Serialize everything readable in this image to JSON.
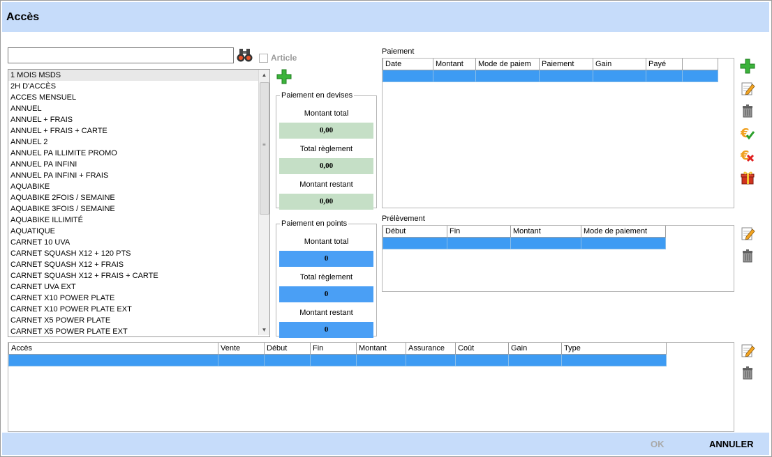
{
  "window": {
    "title": "Accès"
  },
  "search": {
    "value": "",
    "placeholder": ""
  },
  "article_checkbox": {
    "label": "Article",
    "checked": false
  },
  "access_list": {
    "selected_index": 0,
    "items": [
      "1 MOIS MSDS",
      "2H D'ACCÈS",
      "ACCES MENSUEL",
      "ANNUEL",
      "ANNUEL + FRAIS",
      "ANNUEL + FRAIS + CARTE",
      "ANNUEL 2",
      "ANNUEL PA ILLIMITE PROMO",
      "ANNUEL PA INFINI",
      "ANNUEL PA INFINI + FRAIS",
      "AQUABIKE",
      "AQUABIKE 2FOIS / SEMAINE",
      "AQUABIKE 3FOIS / SEMAINE",
      "AQUABIKE ILLIMITÉ",
      "AQUATIQUE",
      "CARNET 10 UVA",
      "CARNET SQUASH  X12 + 120 PTS",
      "CARNET SQUASH  X12 + FRAIS",
      "CARNET SQUASH  X12 + FRAIS + CARTE",
      "CARNET UVA EXT",
      "CARNET X10 POWER PLATE",
      "CARNET X10 POWER PLATE EXT",
      "CARNET X5 POWER PLATE",
      "CARNET X5 POWER PLATE EXT"
    ]
  },
  "currency_payment": {
    "legend": "Paiement en devises",
    "total_label": "Montant total",
    "total_value": "0,00",
    "paid_label": "Total règlement",
    "paid_value": "0,00",
    "remaining_label": "Montant restant",
    "remaining_value": "0,00"
  },
  "points_payment": {
    "legend": "Paiement en points",
    "total_label": "Montant total",
    "total_value": "0",
    "paid_label": "Total règlement",
    "paid_value": "0",
    "remaining_label": "Montant restant",
    "remaining_value": "0"
  },
  "payment_grid": {
    "caption": "Paiement",
    "columns": [
      "Date",
      "Montant",
      "Mode de paiem",
      "Paiement",
      "Gain",
      "Payé",
      ""
    ]
  },
  "debit_grid": {
    "caption": "Prélèvement",
    "columns": [
      "Début",
      "Fin",
      "Montant",
      "Mode de paiement"
    ]
  },
  "access_grid": {
    "columns": [
      "Accès",
      "Vente",
      "Début",
      "Fin",
      "Montant",
      "Assurance",
      "Coût",
      "Gain",
      "Type"
    ]
  },
  "footer": {
    "ok_label": "OK",
    "cancel_label": "ANNULER"
  },
  "colors": {
    "header_bg": "#c6dcfa",
    "selection_blue": "#3d9bf3",
    "currency_green": "#c5dfc6",
    "points_blue": "#4a9ff5"
  },
  "icons": [
    "binoculars-icon",
    "add-icon",
    "edit-icon",
    "trash-icon",
    "euro-check-icon",
    "euro-cancel-icon",
    "gift-icon"
  ]
}
